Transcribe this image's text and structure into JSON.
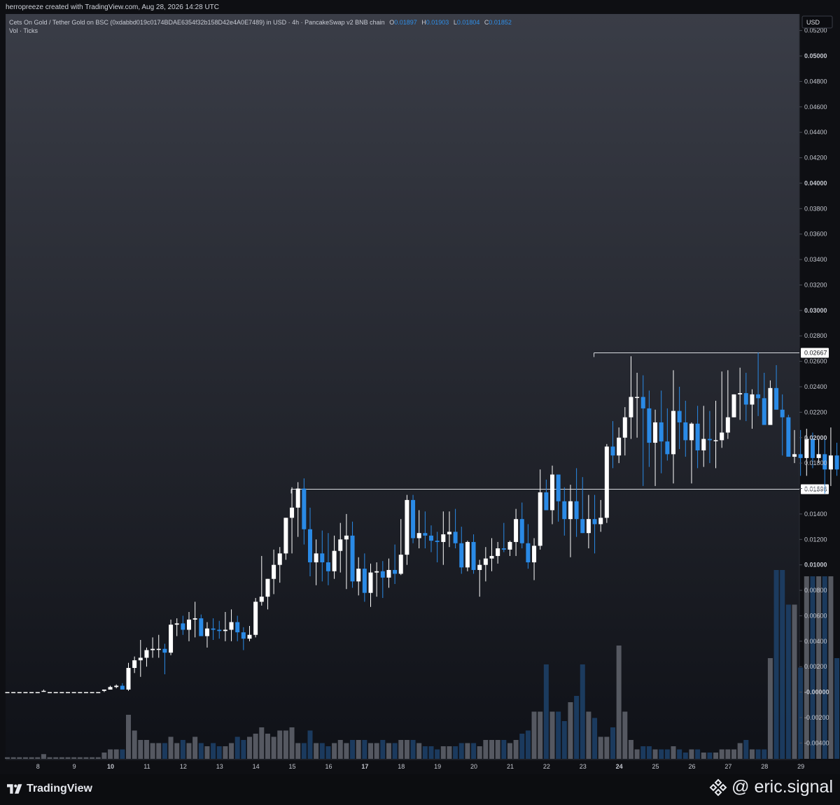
{
  "header": {
    "credit": "herropreeze created with TradingView.com, Aug 28, 2026 14:28 UTC"
  },
  "legend": {
    "symbol_line": "Cets On Gold / Tether Gold on BSC (0xdabbd019c0174BDAE6354f32b158D42e4A0E7489) in USD · 4h · PancakeSwap v2 BNB chain",
    "open_label": "O",
    "open": "0.01897",
    "high_label": "H",
    "high": "0.01903",
    "low_label": "L",
    "low": "0.01804",
    "close_label": "C",
    "close": "0.01852",
    "volume_label": "Vol · Ticks"
  },
  "footer": {
    "brand": "TradingView",
    "watermark": "@ eric.signal",
    "brand_icon": "tradingview-logo-icon",
    "watermark_icon": "binance-logo-icon"
  },
  "colors": {
    "up": "#ffffff",
    "down": "#2a8ae6",
    "volume_up": "#5d6069",
    "volume_down": "#1d3f66",
    "level_line": "#d9dbe0",
    "bg_top": "#3a3d47",
    "bg_bottom": "#0f1117"
  },
  "chart_data": {
    "type": "candlestick",
    "title": "Cets On Gold / Tether Gold on BSC",
    "interval": "4h",
    "currency": "USD",
    "currency_label": "USD",
    "ylim": [
      -0.0053,
      0.0533
    ],
    "y_ticks": [
      "0.05200",
      "0.05000",
      "0.04800",
      "0.04600",
      "0.04400",
      "0.04200",
      "0.04000",
      "0.03800",
      "0.03600",
      "0.03400",
      "0.03200",
      "0.03000",
      "0.02800",
      "0.02600",
      "0.02400",
      "0.02200",
      "0.02000",
      "0.01800",
      "0.01600",
      "0.01400",
      "0.01200",
      "0.01000",
      "0.00800",
      "0.00600",
      "0.00400",
      "0.00200",
      "-0.00000",
      "-0.00200",
      "-0.00400"
    ],
    "y_ticks_bold": [
      "0.05000",
      "0.04000",
      "0.03000",
      "0.02000",
      "0.01000",
      "-0.00000"
    ],
    "x_ticks": [
      {
        "label": "8",
        "bold": false,
        "bar": 5
      },
      {
        "label": "9",
        "bold": false,
        "bar": 11
      },
      {
        "label": "10",
        "bold": true,
        "bar": 17
      },
      {
        "label": "11",
        "bold": false,
        "bar": 23
      },
      {
        "label": "12",
        "bold": false,
        "bar": 29
      },
      {
        "label": "13",
        "bold": false,
        "bar": 35
      },
      {
        "label": "14",
        "bold": false,
        "bar": 41
      },
      {
        "label": "15",
        "bold": false,
        "bar": 47
      },
      {
        "label": "16",
        "bold": false,
        "bar": 53
      },
      {
        "label": "17",
        "bold": true,
        "bar": 59
      },
      {
        "label": "18",
        "bold": false,
        "bar": 65
      },
      {
        "label": "19",
        "bold": false,
        "bar": 71
      },
      {
        "label": "20",
        "bold": false,
        "bar": 77
      },
      {
        "label": "21",
        "bold": false,
        "bar": 83
      },
      {
        "label": "22",
        "bold": false,
        "bar": 89
      },
      {
        "label": "23",
        "bold": false,
        "bar": 95
      },
      {
        "label": "24",
        "bold": true,
        "bar": 101
      },
      {
        "label": "25",
        "bold": false,
        "bar": 107
      },
      {
        "label": "26",
        "bold": false,
        "bar": 113
      },
      {
        "label": "27",
        "bold": false,
        "bar": 119
      },
      {
        "label": "28",
        "bold": false,
        "bar": 125
      },
      {
        "label": "29",
        "bold": false,
        "bar": 131
      }
    ],
    "levels": [
      {
        "label": "0.02667",
        "value": 0.02667,
        "from_bar": 97
      },
      {
        "label": "0.01596",
        "value": 0.01596,
        "from_bar": 47
      }
    ],
    "candles": [
      [
        0,
        0,
        0,
        0,
        0.05
      ],
      [
        0,
        0,
        0,
        0,
        0.05
      ],
      [
        0,
        0,
        0,
        0,
        0.05
      ],
      [
        0,
        0,
        0,
        0,
        0.05
      ],
      [
        0,
        0,
        0,
        0,
        0.05
      ],
      [
        0,
        0,
        0,
        0,
        0.05
      ],
      [
        0.0001,
        0.0002,
        0.0001,
        0.0001,
        0.15
      ],
      [
        0,
        0,
        0,
        0,
        0.05
      ],
      [
        0,
        0,
        0,
        0,
        0.05
      ],
      [
        0,
        0,
        0,
        0,
        0.05
      ],
      [
        0,
        0,
        0,
        0,
        0.05
      ],
      [
        0,
        0,
        0,
        0,
        0.05
      ],
      [
        0,
        0,
        0,
        0,
        0.05
      ],
      [
        0,
        0,
        0,
        0,
        0.05
      ],
      [
        0,
        0,
        0,
        0,
        0.05
      ],
      [
        0,
        0,
        0,
        0,
        0.05
      ],
      [
        0.0001,
        0.0002,
        0,
        0.0002,
        0.2
      ],
      [
        0.0002,
        0.0005,
        0.0002,
        0.0004,
        0.3
      ],
      [
        0.0004,
        0.0006,
        0.0003,
        0.0005,
        0.3
      ],
      [
        0.0005,
        0.0007,
        0.0003,
        0.0002,
        0.3
      ],
      [
        0.0002,
        0.0023,
        0.0001,
        0.0019,
        1.4
      ],
      [
        0.0019,
        0.0028,
        0.0015,
        0.0025,
        0.9
      ],
      [
        0.0025,
        0.0041,
        0.0012,
        0.0027,
        0.6
      ],
      [
        0.0027,
        0.0035,
        0.002,
        0.0033,
        0.6
      ],
      [
        0.0033,
        0.0043,
        0.0027,
        0.0034,
        0.5
      ],
      [
        0.0034,
        0.0045,
        0.0027,
        0.0034,
        0.5
      ],
      [
        0.0034,
        0.0038,
        0.0014,
        0.0031,
        0.5
      ],
      [
        0.0031,
        0.0057,
        0.0029,
        0.0053,
        0.7
      ],
      [
        0.0053,
        0.0058,
        0.0044,
        0.0054,
        0.5
      ],
      [
        0.0054,
        0.006,
        0.0045,
        0.0049,
        0.6
      ],
      [
        0.0049,
        0.0063,
        0.004,
        0.0057,
        0.5
      ],
      [
        0.0057,
        0.0071,
        0.0043,
        0.0058,
        0.7
      ],
      [
        0.0058,
        0.0061,
        0.0047,
        0.0044,
        0.5
      ],
      [
        0.0044,
        0.0055,
        0.0035,
        0.005,
        0.4
      ],
      [
        0.005,
        0.0058,
        0.0041,
        0.0049,
        0.5
      ],
      [
        0.0049,
        0.0056,
        0.0042,
        0.0048,
        0.4
      ],
      [
        0.0048,
        0.0063,
        0.004,
        0.0049,
        0.4
      ],
      [
        0.0049,
        0.0065,
        0.004,
        0.0055,
        0.5
      ],
      [
        0.0055,
        0.006,
        0.004,
        0.0047,
        0.7
      ],
      [
        0.0047,
        0.0051,
        0.0033,
        0.0042,
        0.6
      ],
      [
        0.0042,
        0.0052,
        0.004,
        0.0045,
        0.7
      ],
      [
        0.0045,
        0.0074,
        0.0043,
        0.0071,
        0.8
      ],
      [
        0.0071,
        0.0107,
        0.0068,
        0.0075,
        1.0
      ],
      [
        0.0075,
        0.0086,
        0.0065,
        0.0089,
        0.8
      ],
      [
        0.0089,
        0.0112,
        0.0077,
        0.01,
        0.7
      ],
      [
        0.01,
        0.0114,
        0.0086,
        0.0109,
        0.9
      ],
      [
        0.0109,
        0.0133,
        0.0104,
        0.0137,
        0.9
      ],
      [
        0.0137,
        0.0161,
        0.0109,
        0.0145,
        1.0
      ],
      [
        0.0145,
        0.0165,
        0.0122,
        0.016,
        0.5
      ],
      [
        0.016,
        0.0168,
        0.0116,
        0.0128,
        0.5
      ],
      [
        0.0128,
        0.0145,
        0.0091,
        0.0102,
        0.9
      ],
      [
        0.0102,
        0.012,
        0.0084,
        0.0109,
        0.5
      ],
      [
        0.0109,
        0.0127,
        0.0087,
        0.0102,
        0.5
      ],
      [
        0.0102,
        0.0125,
        0.0084,
        0.0095,
        0.4
      ],
      [
        0.0095,
        0.0123,
        0.0089,
        0.0111,
        0.5
      ],
      [
        0.0111,
        0.0133,
        0.0094,
        0.012,
        0.6
      ],
      [
        0.012,
        0.014,
        0.0081,
        0.0123,
        0.5
      ],
      [
        0.0123,
        0.0134,
        0.0082,
        0.0087,
        0.6
      ],
      [
        0.0087,
        0.0106,
        0.0076,
        0.0097,
        0.6
      ],
      [
        0.0097,
        0.0109,
        0.0071,
        0.0078,
        0.6
      ],
      [
        0.0078,
        0.0101,
        0.0067,
        0.0094,
        0.5
      ],
      [
        0.0094,
        0.0102,
        0.0075,
        0.0095,
        0.5
      ],
      [
        0.0095,
        0.0103,
        0.0074,
        0.009,
        0.6
      ],
      [
        0.009,
        0.0105,
        0.0082,
        0.0096,
        0.5
      ],
      [
        0.0096,
        0.0116,
        0.0085,
        0.0093,
        0.5
      ],
      [
        0.0093,
        0.0136,
        0.0092,
        0.0108,
        0.6
      ],
      [
        0.0108,
        0.0155,
        0.01,
        0.0151,
        0.6
      ],
      [
        0.0151,
        0.0155,
        0.0117,
        0.0121,
        0.6
      ],
      [
        0.0121,
        0.0143,
        0.0113,
        0.0125,
        0.5
      ],
      [
        0.0125,
        0.0142,
        0.0113,
        0.0123,
        0.4
      ],
      [
        0.0123,
        0.0131,
        0.011,
        0.0119,
        0.4
      ],
      [
        0.0119,
        0.0126,
        0.0102,
        0.0118,
        0.3
      ],
      [
        0.0118,
        0.0142,
        0.01,
        0.0124,
        0.4
      ],
      [
        0.0124,
        0.0142,
        0.0114,
        0.0126,
        0.4
      ],
      [
        0.0126,
        0.0144,
        0.0113,
        0.0117,
        0.4
      ],
      [
        0.0117,
        0.013,
        0.0093,
        0.0098,
        0.5
      ],
      [
        0.0098,
        0.0119,
        0.0095,
        0.0118,
        0.5
      ],
      [
        0.0118,
        0.0124,
        0.0093,
        0.0096,
        0.5
      ],
      [
        0.0096,
        0.0104,
        0.0075,
        0.01,
        0.4
      ],
      [
        0.01,
        0.0114,
        0.0087,
        0.0105,
        0.6
      ],
      [
        0.0105,
        0.0121,
        0.0095,
        0.0107,
        0.6
      ],
      [
        0.0107,
        0.0118,
        0.0101,
        0.0113,
        0.6
      ],
      [
        0.0113,
        0.0133,
        0.011,
        0.0112,
        0.6
      ],
      [
        0.0112,
        0.0119,
        0.0107,
        0.0118,
        0.5
      ],
      [
        0.0118,
        0.0144,
        0.0107,
        0.0136,
        0.6
      ],
      [
        0.0136,
        0.0149,
        0.0113,
        0.0117,
        0.8
      ],
      [
        0.0117,
        0.0132,
        0.0097,
        0.0102,
        0.9
      ],
      [
        0.0102,
        0.0121,
        0.0088,
        0.0115,
        1.5
      ],
      [
        0.0115,
        0.0175,
        0.0112,
        0.0157,
        1.5
      ],
      [
        0.0157,
        0.0167,
        0.0144,
        0.0143,
        3.0
      ],
      [
        0.0143,
        0.0178,
        0.0132,
        0.0171,
        1.5
      ],
      [
        0.0171,
        0.0167,
        0.0134,
        0.015,
        1.5
      ],
      [
        0.015,
        0.0161,
        0.0123,
        0.0136,
        1.2
      ],
      [
        0.0136,
        0.0163,
        0.0106,
        0.015,
        1.8
      ],
      [
        0.015,
        0.0176,
        0.0122,
        0.0136,
        2.0
      ],
      [
        0.0136,
        0.0169,
        0.0126,
        0.0125,
        3.0
      ],
      [
        0.0125,
        0.0155,
        0.0113,
        0.0136,
        1.5
      ],
      [
        0.0136,
        0.0155,
        0.0109,
        0.0132,
        1.3
      ],
      [
        0.0132,
        0.0151,
        0.0126,
        0.0137,
        0.7
      ],
      [
        0.0137,
        0.0195,
        0.0133,
        0.0193,
        0.7
      ],
      [
        0.0193,
        0.0213,
        0.0176,
        0.0186,
        1.0
      ],
      [
        0.0186,
        0.0208,
        0.018,
        0.02,
        3.6
      ],
      [
        0.02,
        0.0224,
        0.0186,
        0.0216,
        1.5
      ],
      [
        0.0216,
        0.0264,
        0.0199,
        0.0232,
        0.6
      ],
      [
        0.0232,
        0.0251,
        0.02,
        0.0232,
        0.3
      ],
      [
        0.0232,
        0.0249,
        0.0162,
        0.0223,
        0.4
      ],
      [
        0.0223,
        0.0237,
        0.0177,
        0.0196,
        0.4
      ],
      [
        0.0196,
        0.0222,
        0.0162,
        0.0212,
        0.3
      ],
      [
        0.0212,
        0.0237,
        0.0172,
        0.0197,
        0.3
      ],
      [
        0.0197,
        0.0223,
        0.0182,
        0.0187,
        0.3
      ],
      [
        0.0187,
        0.0253,
        0.0164,
        0.0221,
        0.4
      ],
      [
        0.0221,
        0.024,
        0.0191,
        0.0212,
        0.3
      ],
      [
        0.0212,
        0.0229,
        0.0185,
        0.0198,
        0.2
      ],
      [
        0.0198,
        0.0212,
        0.0164,
        0.0211,
        0.3
      ],
      [
        0.0211,
        0.0225,
        0.0176,
        0.019,
        0.3
      ],
      [
        0.019,
        0.0225,
        0.0177,
        0.0199,
        0.2
      ],
      [
        0.0199,
        0.0221,
        0.018,
        0.0198,
        0.2
      ],
      [
        0.0198,
        0.0229,
        0.0176,
        0.0198,
        0.2
      ],
      [
        0.0198,
        0.0252,
        0.0192,
        0.0204,
        0.3
      ],
      [
        0.0204,
        0.0253,
        0.0199,
        0.0216,
        0.3
      ],
      [
        0.0216,
        0.023,
        0.0217,
        0.0234,
        0.3
      ],
      [
        0.0234,
        0.0255,
        0.0214,
        0.0235,
        0.5
      ],
      [
        0.0235,
        0.0251,
        0.0213,
        0.0226,
        0.6
      ],
      [
        0.0226,
        0.0238,
        0.0207,
        0.0234,
        0.3
      ],
      [
        0.0234,
        0.0267,
        0.0217,
        0.0231,
        0.3
      ],
      [
        0.0231,
        0.0251,
        0.0219,
        0.021,
        0.3
      ],
      [
        0.021,
        0.0245,
        0.022,
        0.0239,
        3.2
      ],
      [
        0.0239,
        0.0257,
        0.0228,
        0.0222,
        6.0
      ],
      [
        0.0222,
        0.0234,
        0.0186,
        0.0216,
        6.0
      ],
      [
        0.0216,
        0.0218,
        0.0191,
        0.0185,
        4.9
      ],
      [
        0.0185,
        0.0206,
        0.018,
        0.0187,
        4.9
      ],
      [
        0.0187,
        0.0206,
        0.017,
        0.0184,
        2.9
      ],
      [
        0.0184,
        0.0207,
        0.017,
        0.0199,
        5.8
      ],
      [
        0.0199,
        0.0204,
        0.0176,
        0.0184,
        5.8
      ],
      [
        0.0184,
        0.0199,
        0.018,
        0.0187,
        5.8
      ],
      [
        0.0187,
        0.0199,
        0.0156,
        0.0175,
        5.8
      ],
      [
        0.0175,
        0.0208,
        0.0162,
        0.0186,
        5.8
      ],
      [
        0.0186,
        0.0196,
        0.017,
        0.0175,
        3.2
      ],
      [
        0.0175,
        0.0201,
        0.0169,
        0.0189,
        0.3
      ],
      [
        0.0189,
        0.0208,
        0.0181,
        0.0185,
        0.3
      ]
    ]
  }
}
